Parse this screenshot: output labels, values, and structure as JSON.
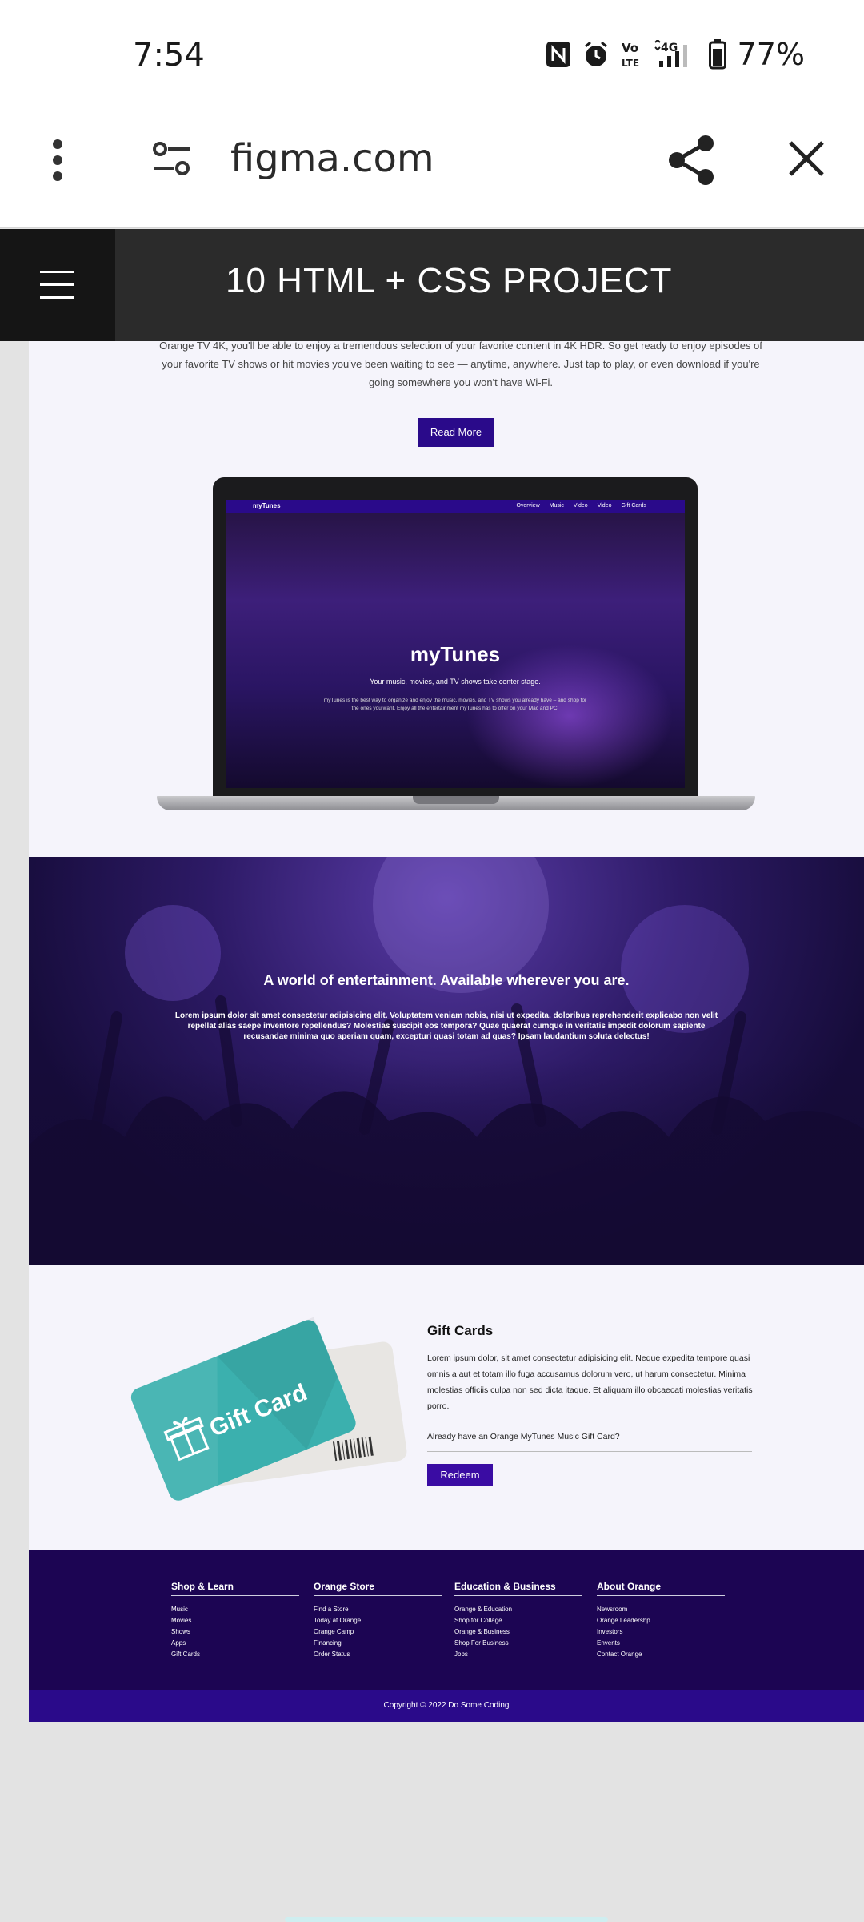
{
  "status_bar": {
    "time": "7:54",
    "battery": "77%"
  },
  "browser": {
    "url": "figma.com"
  },
  "site_header": {
    "title": "10 HTML + CSS PROJECT"
  },
  "intro": {
    "text": "Orange TV 4K, you'll be able to enjoy a tremendous selection of your favorite content in 4K HDR. So get ready to enjoy episodes of your favorite TV shows or hit movies you've been waiting to see — anytime, anywhere. Just tap to play, or even download if you're going somewhere you won't have Wi-Fi.",
    "button": "Read More"
  },
  "laptop_screen": {
    "brand": "myTunes",
    "nav": [
      "Overview",
      "Music",
      "Video",
      "Video",
      "Gift Cards"
    ],
    "title": "myTunes",
    "subtitle": "Your music, movies, and TV shows take center stage.",
    "body": "myTunes is the best way to organize and enjoy the music, movies, and TV shows you already have – and shop for the ones you want. Enjoy all the entertainment myTunes has to offer on your Mac and PC."
  },
  "entertainment": {
    "heading": "A world of entertainment. Available wherever you are.",
    "text": "Lorem ipsum dolor sit amet consectetur adipisicing elit. Voluptatem veniam nobis, nisi ut expedita, doloribus reprehenderit explicabo non velit repellat alias saepe inventore repellendus? Molestias suscipit eos tempora? Quae quaerat cumque in veritatis impedit dolorum sapiente recusandae minima quo aperiam quam, excepturi quasi totam ad quas? Ipsam laudantium soluta delectus!"
  },
  "gift_cards": {
    "card_label": "Gift Card",
    "heading": "Gift Cards",
    "text": "Lorem ipsum dolor, sit amet consectetur adipisicing elit. Neque expedita tempore quasi omnis a aut et totam illo fuga accusamus dolorum vero, ut harum consectetur. Minima molestias officiis culpa non sed dicta itaque. Et aliquam illo obcaecati molestias veritatis porro.",
    "prompt": "Already have an Orange MyTunes Music Gift Card?",
    "button": "Redeem"
  },
  "footer": {
    "columns": [
      {
        "title": "Shop & Learn",
        "items": [
          "Music",
          "Movies",
          "Shows",
          "Apps",
          "Gift Cards"
        ]
      },
      {
        "title": "Orange Store",
        "items": [
          "Find a Store",
          "Today at Orange",
          "Orange Camp",
          "Financing",
          "Order Status"
        ]
      },
      {
        "title": "Education  & Business",
        "items": [
          "Orange & Education",
          "Shop for Collage",
          "Orange & Business",
          "Shop For Business",
          "Jobs"
        ]
      },
      {
        "title": "About Orange",
        "items": [
          "Newsroom",
          "Orange Leadershp",
          "Investors",
          "Envents",
          "Contact Orange"
        ]
      }
    ],
    "copyright": "Copyright © 2022 Do Some Coding"
  }
}
